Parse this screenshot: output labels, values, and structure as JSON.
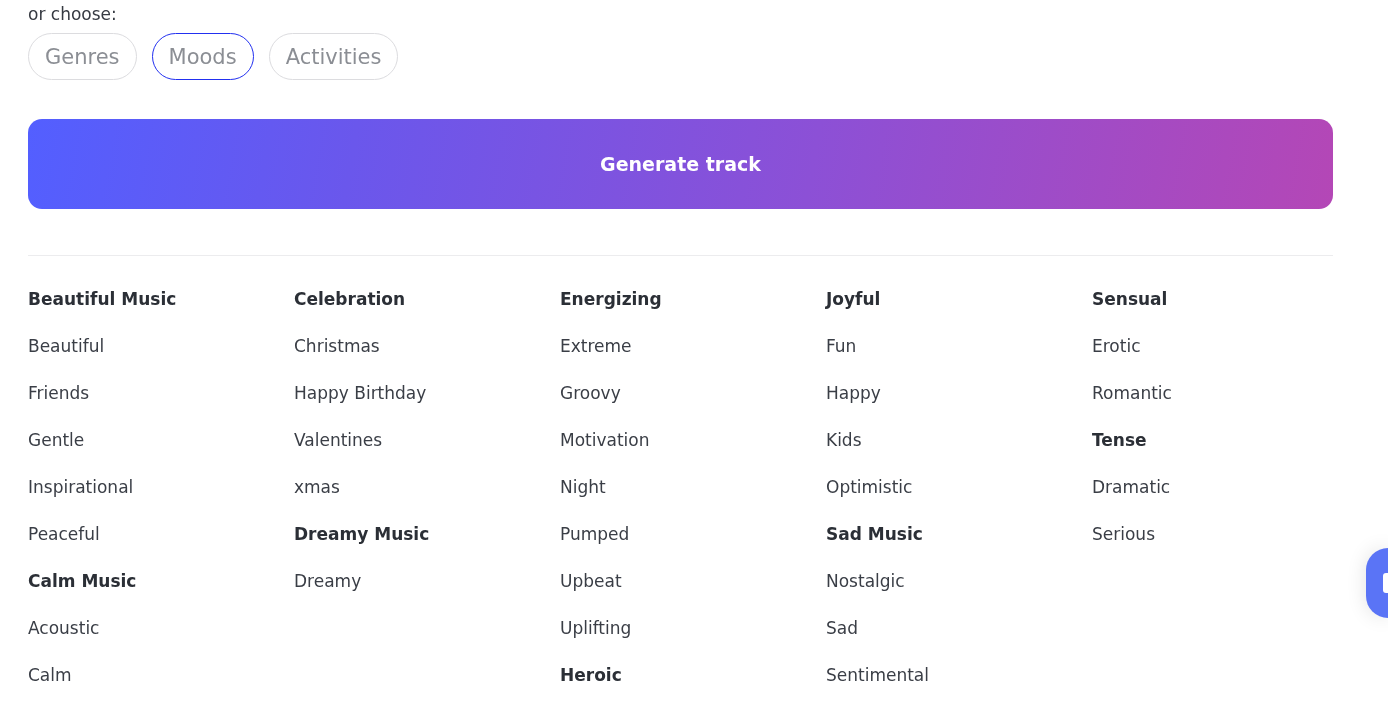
{
  "prompt_label": "or choose:",
  "tabs": [
    {
      "label": "Genres",
      "selected": false
    },
    {
      "label": "Moods",
      "selected": true
    },
    {
      "label": "Activities",
      "selected": false
    }
  ],
  "generate_button": {
    "label": "Generate track"
  },
  "columns": [
    {
      "groups": [
        {
          "title": "Beautiful Music",
          "items": [
            "Beautiful",
            "Friends",
            "Gentle",
            "Inspirational",
            "Peaceful"
          ]
        },
        {
          "title": "Calm Music",
          "items": [
            "Acoustic",
            "Calm"
          ]
        }
      ]
    },
    {
      "groups": [
        {
          "title": "Celebration",
          "items": [
            "Christmas",
            "Happy Birthday",
            "Valentines",
            "xmas"
          ]
        },
        {
          "title": "Dreamy Music",
          "items": [
            "Dreamy"
          ]
        }
      ]
    },
    {
      "groups": [
        {
          "title": "Energizing",
          "items": [
            "Extreme",
            "Groovy",
            "Motivation",
            "Night",
            "Pumped",
            "Upbeat",
            "Uplifting"
          ]
        },
        {
          "title": "Heroic"
        }
      ]
    },
    {
      "groups": [
        {
          "title": "Joyful",
          "items": [
            "Fun",
            "Happy",
            "Kids",
            "Optimistic"
          ]
        },
        {
          "title": "Sad Music",
          "items": [
            "Nostalgic",
            "Sad",
            "Sentimental"
          ]
        }
      ]
    },
    {
      "groups": [
        {
          "title": "Sensual",
          "items": [
            "Erotic",
            "Romantic"
          ]
        },
        {
          "title": "Tense",
          "items": [
            "Dramatic",
            "Serious"
          ]
        }
      ]
    }
  ]
}
